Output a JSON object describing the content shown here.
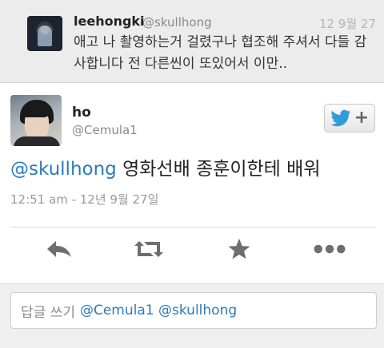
{
  "parent_tweet": {
    "name": "leehongki",
    "handle": "@skullhong",
    "time": "12 9월 27",
    "text": "애고 나 촬영하는거 걸렸구나 협조해 주셔서 다들 감사합니다 전 다른씬이 또있어서 이만.."
  },
  "tweet": {
    "name": "ho",
    "handle": "@Cemula1",
    "mention": "@skullhong",
    "body": " 영화선배 종훈이한테 배워",
    "timestamp": "12:51 am - 12년 9월 27일",
    "follow_icon": "twitter-bird-icon",
    "follow_plus": "+"
  },
  "actions": {
    "items": [
      "reply-icon",
      "retweet-icon",
      "favorite-icon",
      "more-icon"
    ]
  },
  "reply": {
    "placeholder": "답글 쓰기",
    "prefill": "@Cemula1 @skullhong"
  },
  "colors": {
    "link": "#2b7bb9",
    "twitter_blue": "#2f9bd8",
    "icon_gray": "#6e6e6e"
  }
}
